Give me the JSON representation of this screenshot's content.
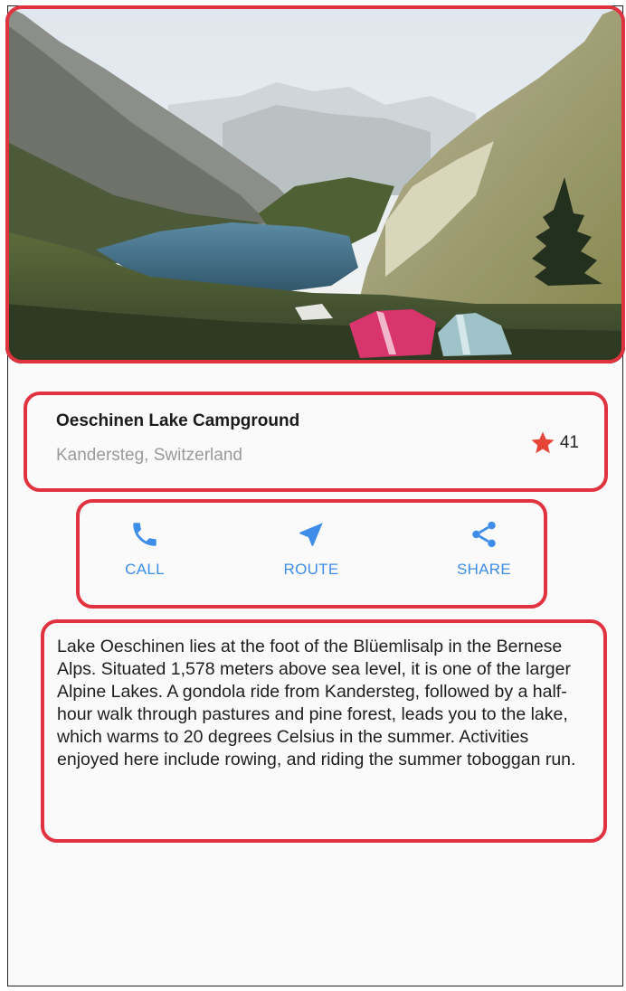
{
  "header_image": {
    "alt": "Oeschinen Lake"
  },
  "place": {
    "name": "Oeschinen Lake Campground",
    "location": "Kandersteg, Switzerland",
    "rating_count": "41"
  },
  "actions": [
    {
      "label": "CALL",
      "icon": "phone-icon"
    },
    {
      "label": "ROUTE",
      "icon": "navigation-arrow-icon"
    },
    {
      "label": "SHARE",
      "icon": "share-icon"
    }
  ],
  "description": "Lake Oeschinen lies at the foot of the Blüemlisalp in the Bernese Alps. Situated 1,578 meters above sea level, it is one of the larger Alpine Lakes. A gondola ride from Kandersteg, followed by a half-hour walk through pastures and pine forest, leads you to the lake, which warms to 20 degrees Celsius in the summer. Activities enjoyed here include rowing, and riding the summer toboggan run.",
  "colors": {
    "highlight": "#e0323f",
    "accent": "#3e8de8",
    "star": "#e4473a"
  }
}
